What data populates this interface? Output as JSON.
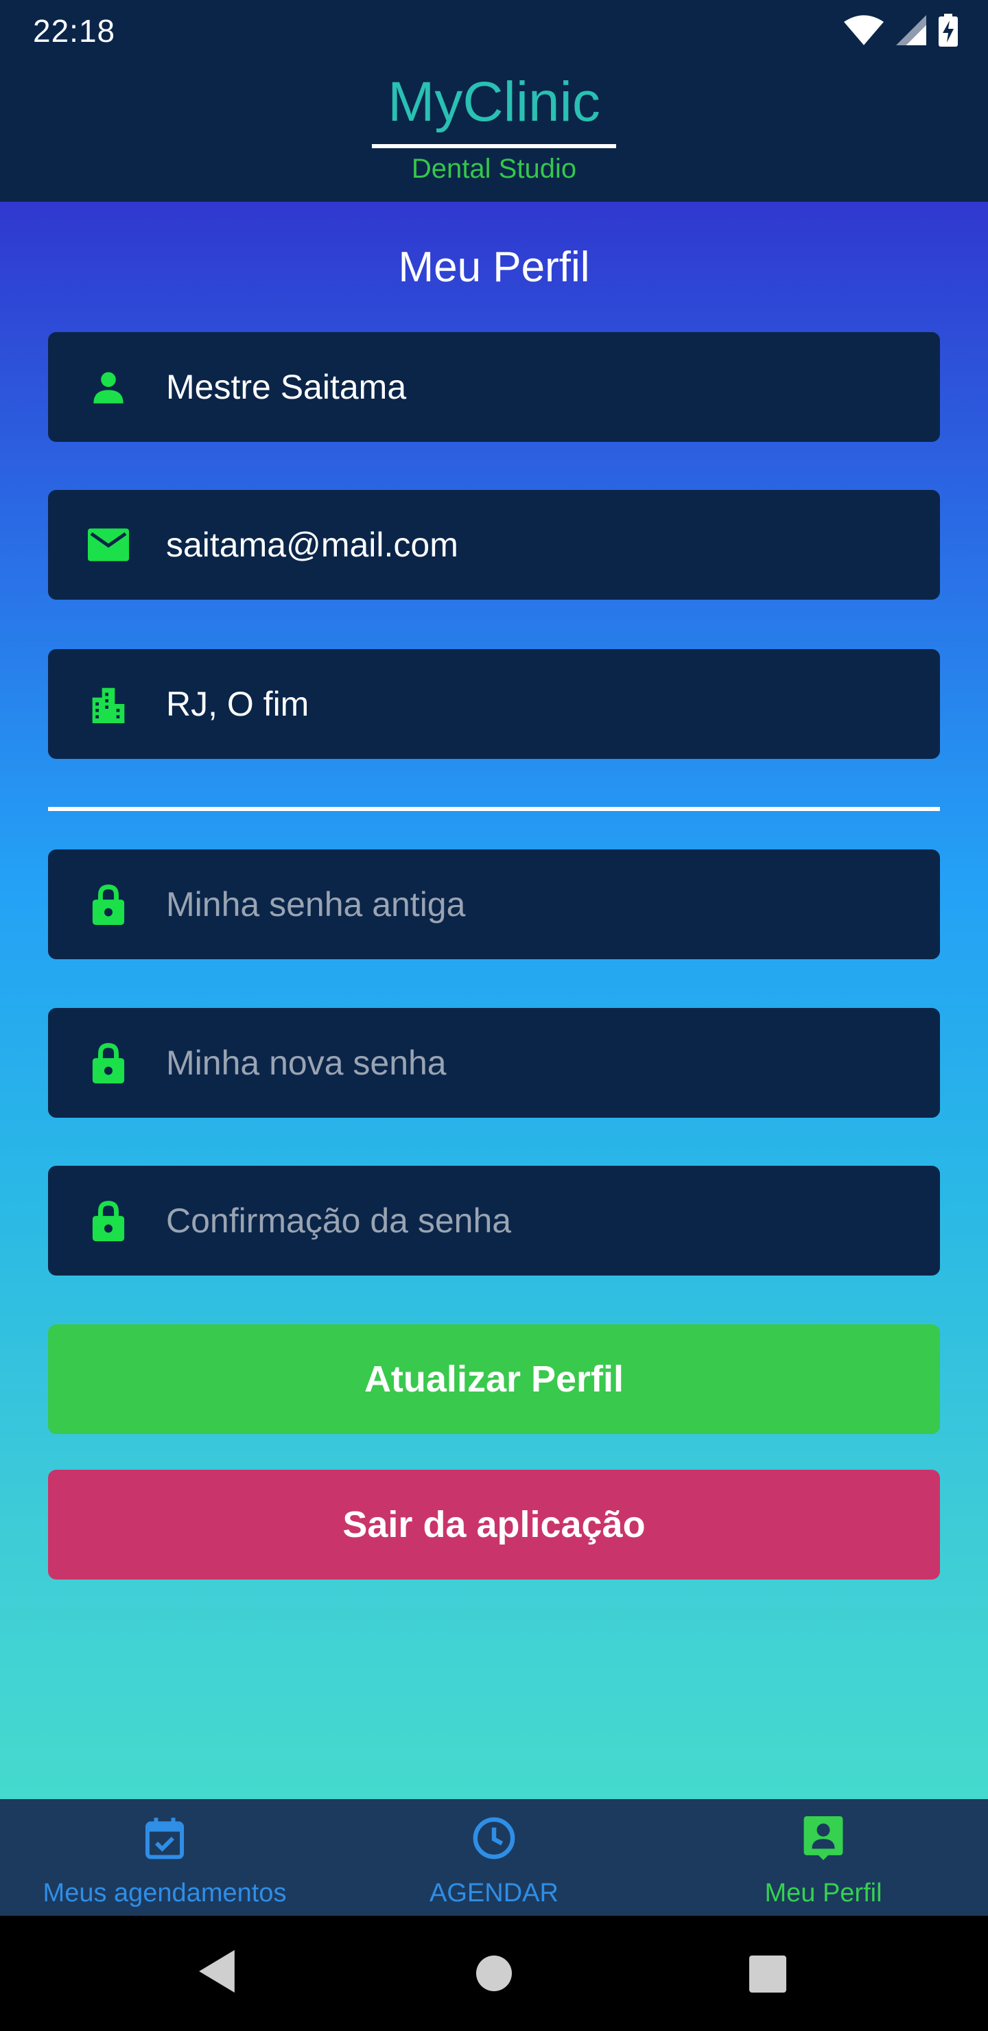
{
  "status_bar": {
    "time": "22:18",
    "icons": [
      "wifi-icon",
      "signal-icon",
      "battery-charging-icon"
    ]
  },
  "header": {
    "title": "MyClinic",
    "subtitle": "Dental Studio"
  },
  "profile": {
    "page_title": "Meu Perfil",
    "name": "Mestre Saitama",
    "email": "saitama@mail.com",
    "address": "RJ, O fim"
  },
  "password": {
    "old_placeholder": "Minha senha antiga",
    "new_placeholder": "Minha nova senha",
    "confirm_placeholder": "Confirmação da senha"
  },
  "buttons": {
    "update_label": "Atualizar Perfil",
    "exit_label": "Sair da aplicação"
  },
  "bottom_nav": {
    "items": [
      {
        "label": "Meus agendamentos",
        "icon": "calendar-check-icon"
      },
      {
        "label": "AGENDAR",
        "icon": "clock-icon"
      },
      {
        "label": "Meu Perfil",
        "icon": "profile-card-icon"
      }
    ],
    "active_index": 2
  },
  "colors": {
    "header_bg": "#0b2549",
    "brand": "#2ac0b3",
    "accent_green": "#35c74a",
    "icon_green": "#1be04a",
    "update_button": "#39c94d",
    "exit_button": "#c9356a",
    "nav_inactive": "#2f8ee6",
    "nav_active": "#35d14f"
  }
}
